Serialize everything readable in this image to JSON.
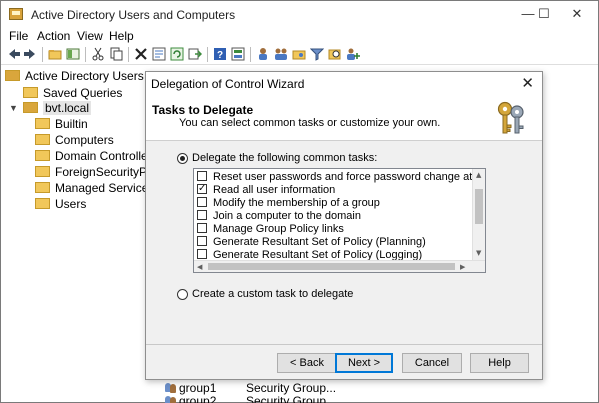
{
  "window": {
    "title": "Active Directory Users and Computers",
    "controls": {
      "minimize": "—",
      "maximize": "☐",
      "close": "✕"
    }
  },
  "menu": [
    "File",
    "Action",
    "View",
    "Help"
  ],
  "toolbar_icons": [
    "back-icon",
    "forward-icon",
    "up-folder-icon",
    "console-tree-icon",
    "cut-icon",
    "copy-icon",
    "delete-icon",
    "properties-icon",
    "refresh-icon",
    "export-icon",
    "help-icon",
    "help-topics-icon",
    "new-user-icon",
    "new-group-icon",
    "new-ou-icon",
    "filter-icon",
    "find-icon",
    "add-to-group-icon"
  ],
  "tree": {
    "root": "Active Directory Users and Co",
    "items": [
      {
        "label": "Saved Queries",
        "level": 1
      },
      {
        "label": "bvt.local",
        "level": 1,
        "selected": true
      },
      {
        "label": "Builtin",
        "level": 2
      },
      {
        "label": "Computers",
        "level": 2
      },
      {
        "label": "Domain Controllers",
        "level": 2
      },
      {
        "label": "ForeignSecurityPrincip",
        "level": 2
      },
      {
        "label": "Managed Service Acco",
        "level": 2
      },
      {
        "label": "Users",
        "level": 2
      }
    ]
  },
  "behind_rows": [
    {
      "name": "group1",
      "type": "Security Group..."
    },
    {
      "name": "group2",
      "type": "Security Group..."
    }
  ],
  "dialog": {
    "title": "Delegation of Control Wizard",
    "close": "✕",
    "header_title": "Tasks to Delegate",
    "header_subtitle": "You can select common tasks or customize your own.",
    "option_common": "Delegate the following common tasks:",
    "option_custom": "Create a custom task to delegate",
    "selected_option": "common",
    "tasks": [
      {
        "label": "Reset user passwords and force password change at next logon",
        "checked": false
      },
      {
        "label": "Read all user information",
        "checked": true
      },
      {
        "label": "Modify the membership of a group",
        "checked": false
      },
      {
        "label": "Join a computer to the domain",
        "checked": false
      },
      {
        "label": "Manage Group Policy links",
        "checked": false
      },
      {
        "label": "Generate Resultant Set of Policy (Planning)",
        "checked": false
      },
      {
        "label": "Generate Resultant Set of Policy (Logging)",
        "checked": false
      }
    ],
    "buttons": {
      "back": "< Back",
      "next": "Next >",
      "cancel": "Cancel",
      "help": "Help"
    }
  }
}
